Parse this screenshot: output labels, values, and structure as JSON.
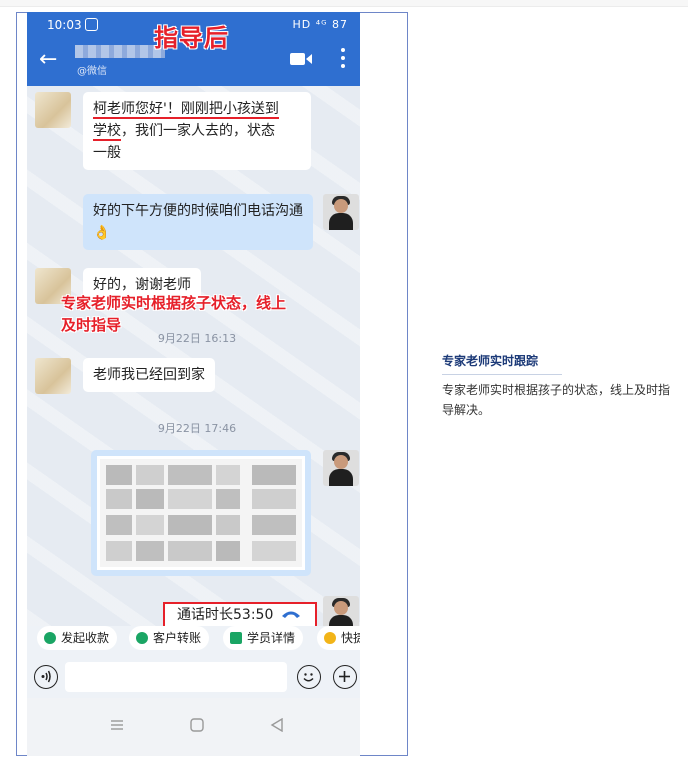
{
  "overlay": {
    "title": "指导后",
    "annotation_line1": "专家老师实时根据孩子状态，线上",
    "annotation_line2": "及时指导"
  },
  "statusbar": {
    "time": "10:03",
    "indicators": "HD ⁴ᴳ 87"
  },
  "header": {
    "back_icon": "arrow-left-icon",
    "contact_subtitle": "@微信",
    "video_icon": "video-camera-icon",
    "more_icon": "more-vertical-icon"
  },
  "messages": [
    {
      "side": "left",
      "line1_underlined": "柯老师您好'！刚刚把小孩送到",
      "line2_underlined": "学校",
      "line2_rest": "，我们一家人去的，状态",
      "line3": "一般"
    },
    {
      "side": "right",
      "text": "好的下午方便的时候咱们电话沟通👌"
    },
    {
      "side": "left",
      "text": "好的，谢谢老师"
    },
    {
      "side": "left",
      "text": "老师我已经回到家"
    }
  ],
  "timestamps": {
    "first": "9月22日 16:13",
    "second": "9月22日 17:46"
  },
  "call": {
    "text": "通话时长53:50",
    "icon": "phone-hangup-icon"
  },
  "quick_actions": [
    {
      "label": "发起收款",
      "icon": "yuan-icon",
      "color": "#1aa564"
    },
    {
      "label": "客户转账",
      "icon": "transfer-icon",
      "color": "#1aa564"
    },
    {
      "label": "学员详情",
      "icon": "user-icon",
      "color": "#1aa564"
    },
    {
      "label": "快捷",
      "icon": "quick-icon",
      "color": "#f2b418"
    }
  ],
  "sidebar": {
    "title": "专家老师实时跟踪",
    "description": "专家老师实时根据孩子的状态，线上及时指导解决。"
  },
  "colors": {
    "header_blue": "#2f6fd0",
    "accent_red": "#e6202a",
    "bubble_blue": "#cfe4fb"
  }
}
